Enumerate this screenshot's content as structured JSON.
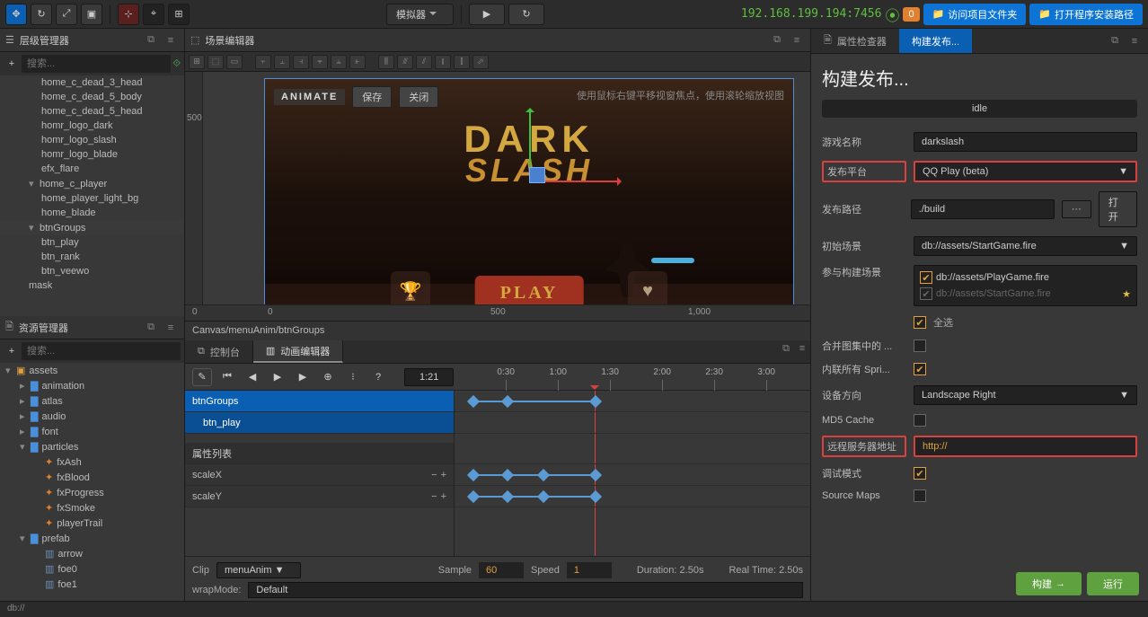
{
  "toolbar": {
    "simulator": "模拟器",
    "ip": "192.168.199.194:7456",
    "notification_count": "0",
    "visit_folder": "访问项目文件夹",
    "open_install_path": "打开程序安装路径"
  },
  "hierarchy": {
    "title": "层级管理器",
    "search_placeholder": "搜索...",
    "items": [
      {
        "label": "home_c_dead_3_head",
        "depth": 2
      },
      {
        "label": "home_c_dead_5_body",
        "depth": 2
      },
      {
        "label": "home_c_dead_5_head",
        "depth": 2
      },
      {
        "label": "homr_logo_dark",
        "depth": 2
      },
      {
        "label": "homr_logo_slash",
        "depth": 2
      },
      {
        "label": "homr_logo_blade",
        "depth": 2
      },
      {
        "label": "efx_flare",
        "depth": 2
      },
      {
        "label": "home_c_player",
        "depth": 1,
        "arrow": "▾"
      },
      {
        "label": "home_player_light_bg",
        "depth": 2
      },
      {
        "label": "home_blade",
        "depth": 2
      },
      {
        "label": "btnGroups",
        "depth": 1,
        "arrow": "▾",
        "sel": true
      },
      {
        "label": "btn_play",
        "depth": 2
      },
      {
        "label": "btn_rank",
        "depth": 2
      },
      {
        "label": "btn_veewo",
        "depth": 2
      },
      {
        "label": "mask",
        "depth": 1
      }
    ]
  },
  "assets": {
    "title": "资源管理器",
    "search_placeholder": "搜索...",
    "tree": [
      {
        "label": "assets",
        "icon": "asset",
        "arrow": "▾",
        "depth": 0
      },
      {
        "label": "animation",
        "icon": "folder",
        "arrow": "▸",
        "depth": 1
      },
      {
        "label": "atlas",
        "icon": "folder",
        "arrow": "▸",
        "depth": 1
      },
      {
        "label": "audio",
        "icon": "folder",
        "arrow": "▸",
        "depth": 1
      },
      {
        "label": "font",
        "icon": "folder",
        "arrow": "▸",
        "depth": 1
      },
      {
        "label": "particles",
        "icon": "folder",
        "arrow": "▾",
        "depth": 1
      },
      {
        "label": "fxAsh",
        "icon": "fire",
        "depth": 2
      },
      {
        "label": "fxBlood",
        "icon": "fire",
        "depth": 2
      },
      {
        "label": "fxProgress",
        "icon": "fire",
        "depth": 2
      },
      {
        "label": "fxSmoke",
        "icon": "fire",
        "depth": 2
      },
      {
        "label": "playerTrail",
        "icon": "fire",
        "depth": 2
      },
      {
        "label": "prefab",
        "icon": "folder",
        "arrow": "▾",
        "depth": 1
      },
      {
        "label": "arrow",
        "icon": "prefab",
        "depth": 2
      },
      {
        "label": "foe0",
        "icon": "prefab",
        "depth": 2
      },
      {
        "label": "foe1",
        "icon": "prefab",
        "depth": 2
      }
    ]
  },
  "scene": {
    "title": "场景编辑器",
    "animate_label": "ANIMATE",
    "save": "保存",
    "close": "关闭",
    "hint": "使用鼠标右键平移视窗焦点，使用滚轮缩放视图",
    "logo_dark": "DARK",
    "logo_slash": "SLASH",
    "play_label": "PLAY",
    "ruler_v": "500",
    "ruler_h": [
      "0",
      "0",
      "500",
      "1,000"
    ],
    "breadcrumb": "Canvas/menuAnim/btnGroups"
  },
  "tabs": {
    "console": "控制台",
    "anim_editor": "动画编辑器"
  },
  "anim": {
    "time": "1:21",
    "ticks": [
      "0:30",
      "1:00",
      "1:30",
      "2:00",
      "2:30",
      "3:00"
    ],
    "tracks": {
      "btnGroups": "btnGroups",
      "btn_play": "btn_play"
    },
    "prop_header": "属性列表",
    "props": [
      "scaleX",
      "scaleY"
    ],
    "clip_label": "Clip",
    "clip_value": "menuAnim",
    "sample_label": "Sample",
    "sample_value": "60",
    "speed_label": "Speed",
    "speed_value": "1",
    "duration": "Duration:  2.50s",
    "realtime": "Real Time:  2.50s",
    "wrap_label": "wrapMode:",
    "wrap_value": "Default"
  },
  "inspector": {
    "tab_props": "属性检查器",
    "tab_build": "构建发布...",
    "title": "构建发布...",
    "status": "idle",
    "game_name_label": "游戏名称",
    "game_name": "darkslash",
    "platform_label": "发布平台",
    "platform": "QQ Play (beta)",
    "path_label": "发布路径",
    "path": "./build",
    "path_open": "打开",
    "start_scene_label": "初始场景",
    "start_scene": "db://assets/StartGame.fire",
    "include_scene_label": "参与构建场景",
    "scenes": [
      {
        "label": "db://assets/PlayGame.fire",
        "checked": true
      },
      {
        "label": "db://assets/StartGame.fire",
        "dim": true,
        "star": true
      }
    ],
    "select_all": "全选",
    "merge_atlas_label": "合并图集中的 ...",
    "inline_sprite_label": "内联所有 Spri...",
    "orientation_label": "设备方向",
    "orientation": "Landscape Right",
    "md5_label": "MD5 Cache",
    "remote_label": "远程服务器地址",
    "remote_value": "http://",
    "debug_label": "调试模式",
    "sourcemap_label": "Source Maps",
    "build_btn": "构建",
    "run_btn": "运行"
  },
  "footer": "db://"
}
